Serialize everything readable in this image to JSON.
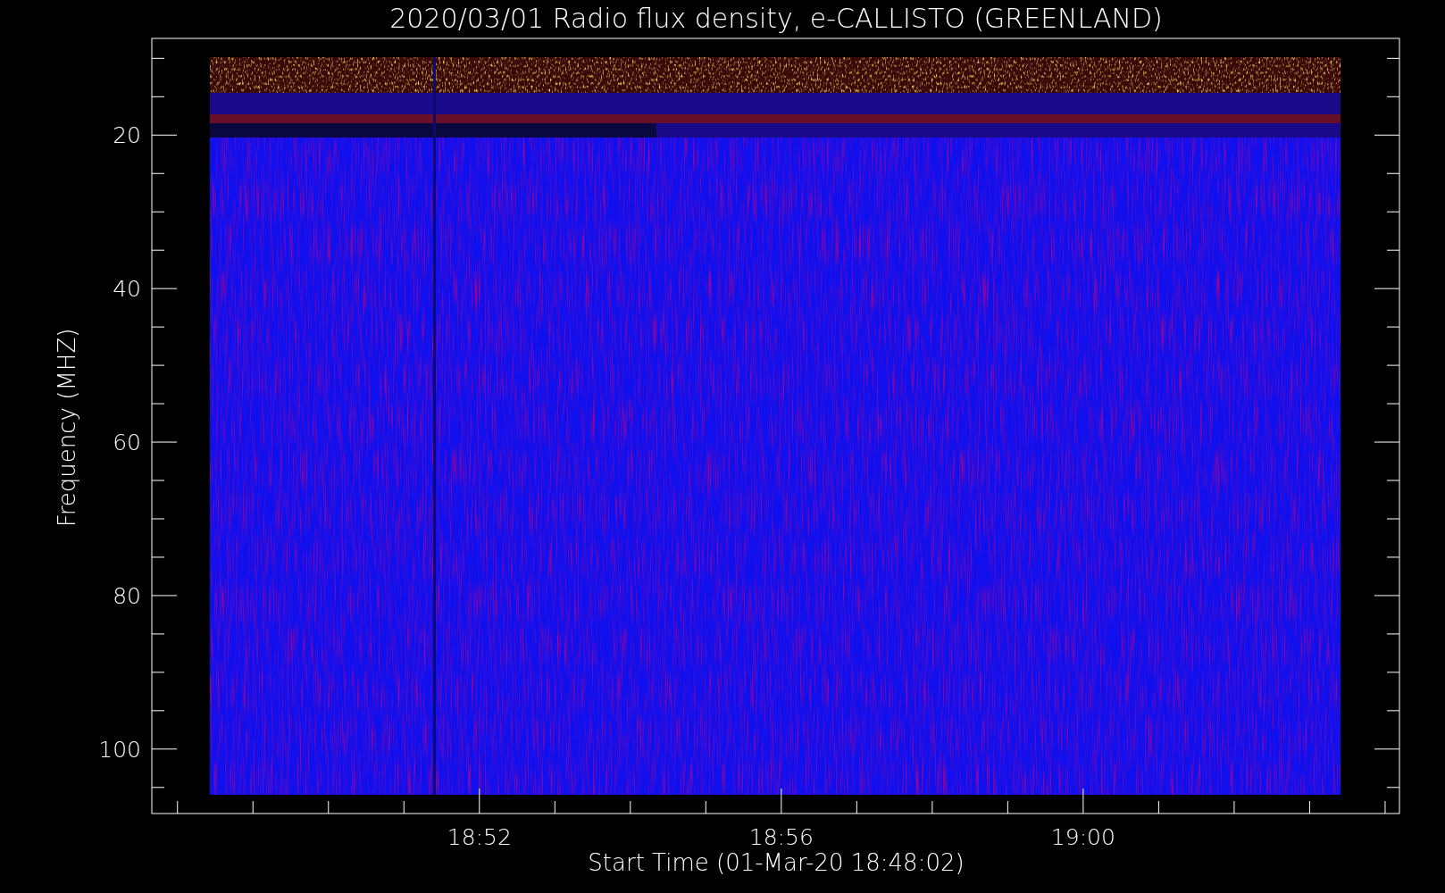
{
  "chart_data": {
    "type": "heatmap",
    "title": "2020/03/01  Radio flux density, e-CALLISTO (GREENLAND)",
    "xlabel": "Start Time (01-Mar-20 18:48:02)",
    "ylabel": "Frequency (MHZ)",
    "xlim": [
      1127.66,
      1144.19
    ],
    "ylim": [
      108.4,
      7.4
    ],
    "xticks": [
      {
        "value": 1132,
        "label": "18:52"
      },
      {
        "value": 1136,
        "label": "18:56"
      },
      {
        "value": 1140,
        "label": "19:00"
      }
    ],
    "yticks": [
      20,
      40,
      60,
      80,
      100
    ]
  }
}
